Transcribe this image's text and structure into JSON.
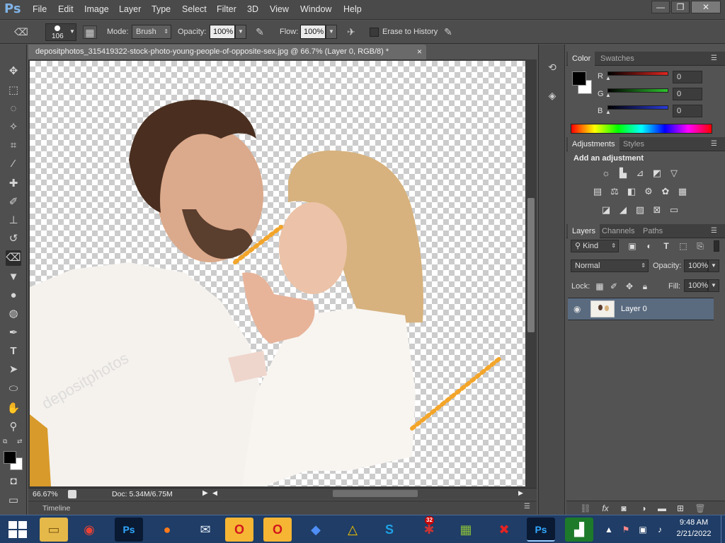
{
  "app": {
    "logo": "Ps"
  },
  "menu": [
    "File",
    "Edit",
    "Image",
    "Layer",
    "Type",
    "Select",
    "Filter",
    "3D",
    "View",
    "Window",
    "Help"
  ],
  "window_controls": {
    "minimize": "—",
    "restore": "❐",
    "close": "✕"
  },
  "options": {
    "brush_size": "106",
    "mode_label": "Mode:",
    "mode_value": "Brush",
    "opacity_label": "Opacity:",
    "opacity_value": "100%",
    "flow_label": "Flow:",
    "flow_value": "100%",
    "erase_history_label": "Erase to History"
  },
  "document": {
    "tab_title": "depositphotos_315419322-stock-photo-young-people-of-opposite-sex.jpg @ 66.7% (Layer 0, RGB/8) *",
    "close": "×",
    "zoom": "66.67%",
    "doc_size": "Doc: 5.34M/6.75M",
    "watermark": "depositphotos"
  },
  "timeline": {
    "label": "Timeline"
  },
  "color_panel": {
    "tabs": [
      "Color",
      "Swatches"
    ],
    "channels": [
      {
        "label": "R",
        "value": "0",
        "color": "#e0261f"
      },
      {
        "label": "G",
        "value": "0",
        "color": "#2ec42e"
      },
      {
        "label": "B",
        "value": "0",
        "color": "#2a3bd9"
      }
    ]
  },
  "adjustments_panel": {
    "tabs": [
      "Adjustments",
      "Styles"
    ],
    "heading": "Add an adjustment"
  },
  "layers_panel": {
    "tabs": [
      "Layers",
      "Channels",
      "Paths"
    ],
    "kind_label": "Kind",
    "blend_mode": "Normal",
    "opacity_label": "Opacity:",
    "opacity_value": "100%",
    "lock_label": "Lock:",
    "fill_label": "Fill:",
    "fill_value": "100%",
    "layers": [
      {
        "name": "Layer 0"
      }
    ]
  },
  "taskbar": {
    "apps": [
      "folder-icon",
      "chrome-icon",
      "photoshop-icon",
      "firefox-icon",
      "thunderbird-icon",
      "opera-icon",
      "opera-gx-icon",
      "app-icon",
      "avast-icon",
      "skype-icon",
      "game-icon",
      "winrar-icon",
      "antivirus-icon",
      "photoshop-icon",
      "chart-icon"
    ],
    "clock_time": "9:48 AM",
    "clock_date": "2/21/2022",
    "badge": "32"
  },
  "colors": {
    "accent": "#7fb3e6",
    "taskbar": "#1f3d66",
    "selected_layer": "#5a6b80"
  }
}
